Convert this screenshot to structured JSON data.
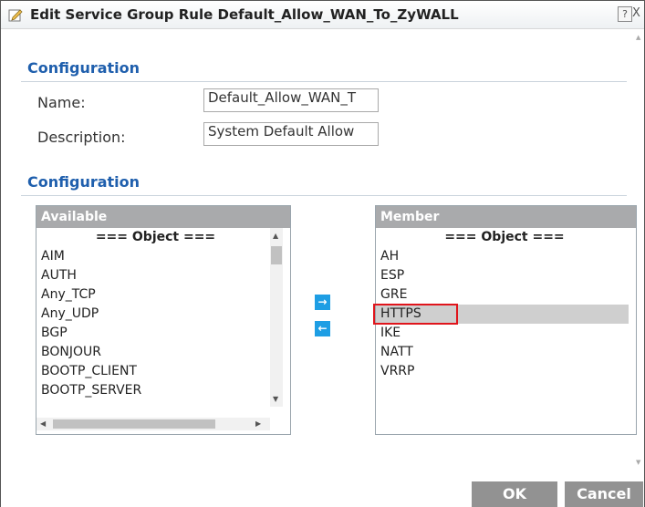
{
  "dialog": {
    "title": "Edit Service Group Rule Default_Allow_WAN_To_ZyWALL",
    "help_label": "?",
    "close_label": "X"
  },
  "config1": {
    "heading": "Configuration",
    "name_label": "Name:",
    "name_value": "Default_Allow_WAN_T",
    "description_label": "Description:",
    "description_value": "System Default Allow"
  },
  "config2": {
    "heading": "Configuration",
    "available": {
      "header": "Available",
      "items": [
        "=== Object ===",
        "AIM",
        "AUTH",
        "Any_TCP",
        "Any_UDP",
        "BGP",
        "BONJOUR",
        "BOOTP_CLIENT",
        "BOOTP_SERVER"
      ]
    },
    "member": {
      "header": "Member",
      "items": [
        "=== Object ===",
        "AH",
        "ESP",
        "GRE",
        "HTTPS",
        "IKE",
        "NATT",
        "VRRP"
      ],
      "selected": "HTTPS"
    },
    "add_icon": "arrow-right-icon",
    "remove_icon": "arrow-left-icon"
  },
  "footer": {
    "ok_label": "OK",
    "cancel_label": "Cancel"
  },
  "colors": {
    "accent": "#1f5fad",
    "button_gray": "#929292",
    "arrow_blue": "#1e9ee4",
    "highlight_red": "#e0151c"
  }
}
